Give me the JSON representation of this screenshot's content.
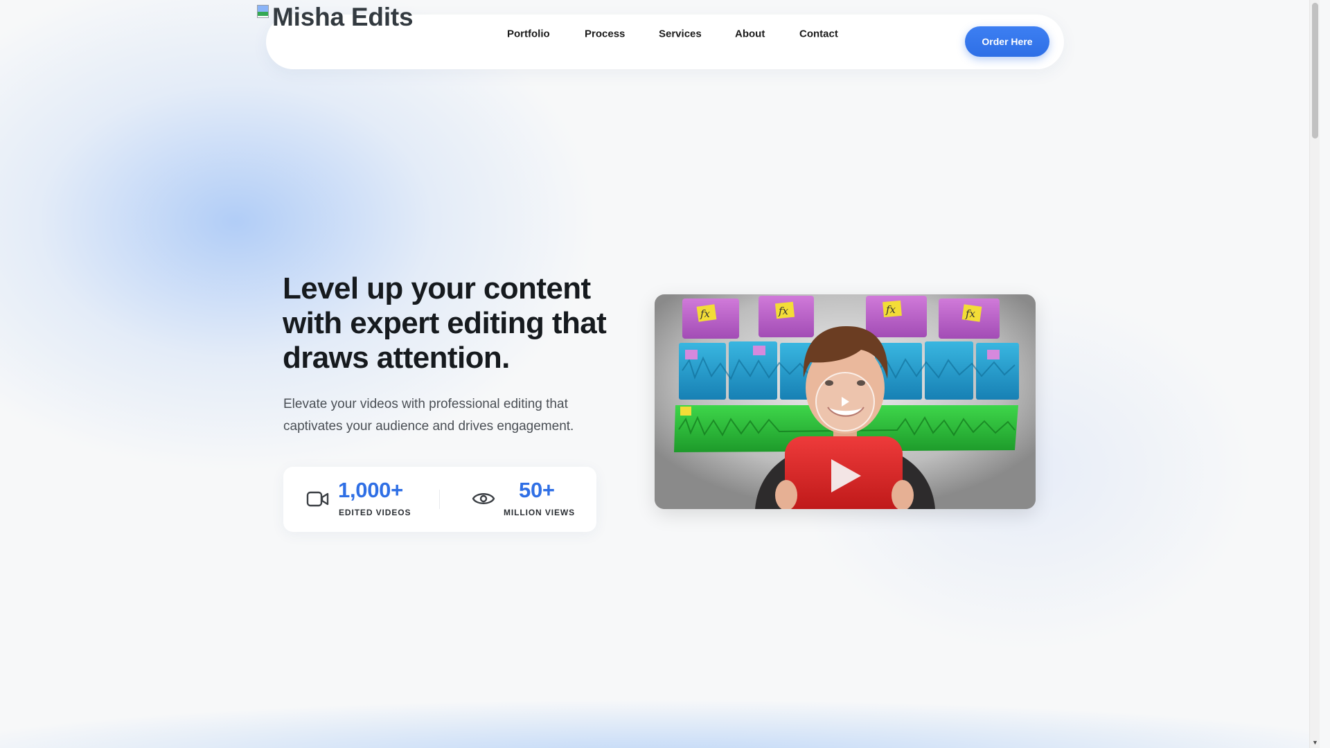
{
  "logo": {
    "alt_text": "Misha Edits",
    "icon": "broken-image-icon"
  },
  "nav": {
    "links": [
      {
        "label": "Portfolio"
      },
      {
        "label": "Process"
      },
      {
        "label": "Services"
      },
      {
        "label": "About"
      },
      {
        "label": "Contact"
      }
    ],
    "cta_label": "Order Here"
  },
  "hero": {
    "title": "Level up your content with expert editing that draws attention.",
    "subtitle": "Elevate your videos with professional editing that captivates your audience and drives engagement.",
    "stats": [
      {
        "icon": "video-camera-icon",
        "value": "1,000+",
        "label": "EDITED VIDEOS"
      },
      {
        "icon": "eye-icon",
        "value": "50+",
        "label": "MILLION VIEWS"
      }
    ]
  },
  "video": {
    "thumbnail_icons": [
      "fx-block-icon",
      "play-icon",
      "youtube-play-icon"
    ]
  },
  "colors": {
    "accent": "#2f6fe5",
    "button": "#3378ec",
    "text": "#161a1e",
    "background": "#f7f8f9"
  }
}
